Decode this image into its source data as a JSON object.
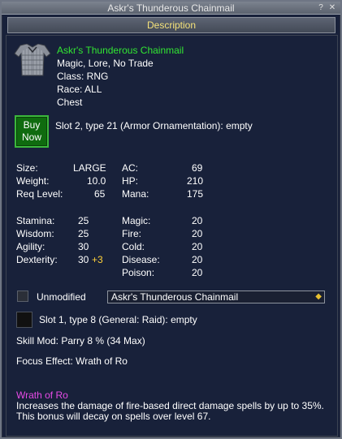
{
  "window": {
    "title": "Askr's Thunderous Chainmail"
  },
  "tab": {
    "label": "Description"
  },
  "item": {
    "name": "Askr's Thunderous Chainmail",
    "flags": "Magic, Lore, No Trade",
    "class": "Class: RNG",
    "race": "Race: ALL",
    "slot": "Chest",
    "icon": "chainmail-icon"
  },
  "buy_button": {
    "line1": "Buy",
    "line2": "Now"
  },
  "ornament_slot": "Slot 2, type 21 (Armor Ornamentation): empty",
  "stats_left": [
    {
      "label": "Size:",
      "value": "LARGE"
    },
    {
      "label": "Weight:",
      "value": "10.0"
    },
    {
      "label": "Req Level:",
      "value": "65"
    }
  ],
  "stats_mid": [
    {
      "label": "AC:",
      "value": "69"
    },
    {
      "label": "HP:",
      "value": "210"
    },
    {
      "label": "Mana:",
      "value": "175"
    }
  ],
  "attributes": [
    {
      "label": "Stamina:",
      "value": "25",
      "bonus": ""
    },
    {
      "label": "Wisdom:",
      "value": "25",
      "bonus": ""
    },
    {
      "label": "Agility:",
      "value": "30",
      "bonus": ""
    },
    {
      "label": "Dexterity:",
      "value": "30",
      "bonus": "+3"
    }
  ],
  "resists": [
    {
      "label": "Magic:",
      "value": "20"
    },
    {
      "label": "Fire:",
      "value": "20"
    },
    {
      "label": "Cold:",
      "value": "20"
    },
    {
      "label": "Disease:",
      "value": "20"
    },
    {
      "label": "Poison:",
      "value": "20"
    }
  ],
  "appearance": {
    "checkbox_label": "Unmodified",
    "select_value": "Askr's Thunderous Chainmail"
  },
  "aug_slot": "Slot 1, type 8 (General: Raid): empty",
  "skill_mod": "Skill Mod: Parry 8 % (34 Max)",
  "focus_effect": "Focus Effect: Wrath of Ro",
  "focus": {
    "name": "Wrath of Ro",
    "desc_line1": "Increases the damage of fire-based direct damage spells by up to 35%.",
    "desc_line2": "This bonus will decay on spells over level 67."
  },
  "colors": {
    "item_name": "#32e632",
    "focus_name": "#e64be6",
    "bonus": "#ffd23a",
    "tab_text": "#f5e27a",
    "buy_button": "#0f6b0f"
  }
}
